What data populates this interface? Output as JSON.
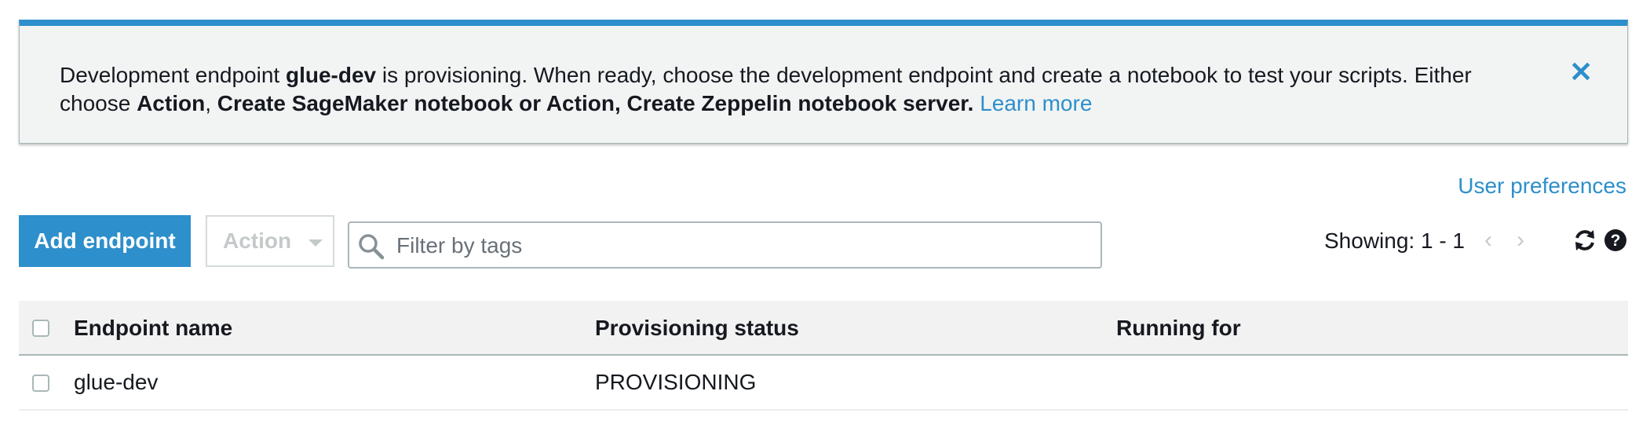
{
  "banner": {
    "text_1": "Development endpoint ",
    "endpoint_name": "glue-dev",
    "text_2": " is provisioning. When ready, choose the development endpoint and create a notebook to test your scripts. Either choose ",
    "bold_1": "Action",
    "text_3": ", ",
    "bold_2": "Create SageMaker notebook or Action, Create Zeppelin notebook server.",
    "learn_more": "Learn more",
    "close_icon": "close-icon"
  },
  "user_preferences": "User preferences",
  "toolbar": {
    "add_endpoint_label": "Add endpoint",
    "action_label": "Action",
    "search_placeholder": "Filter by tags",
    "showing_text": "Showing: 1 - 1",
    "prev_page": "‹",
    "next_page": "›",
    "refresh_icon": "refresh-icon",
    "help_icon": "help-icon"
  },
  "table": {
    "columns": [
      "Endpoint name",
      "Provisioning status",
      "Running for"
    ],
    "rows": [
      {
        "endpoint_name": "glue-dev",
        "provisioning_status": "PROVISIONING",
        "running_for": ""
      }
    ]
  },
  "colors": {
    "accent": "#2d8fcb",
    "banner_bg": "#f2f4f4",
    "header_bg": "#f2f2f2"
  }
}
